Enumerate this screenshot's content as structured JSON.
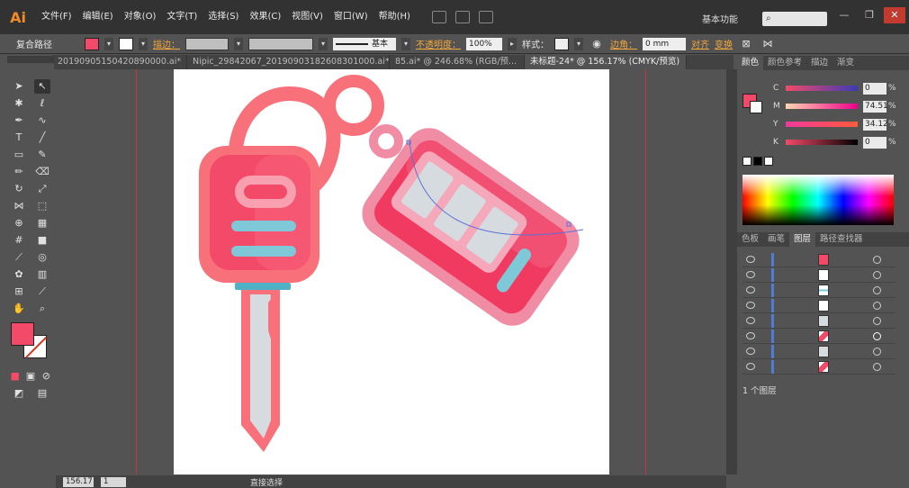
{
  "app": {
    "logo": "Ai"
  },
  "menu": [
    "文件(F)",
    "编辑(E)",
    "对象(O)",
    "文字(T)",
    "选择(S)",
    "效果(C)",
    "视图(V)",
    "窗口(W)",
    "帮助(H)"
  ],
  "workspace_label": "基本功能",
  "search_placeholder": "",
  "control": {
    "object_type": "复合路径",
    "stroke_label": "描边：",
    "stroke_style": "基本",
    "opacity_label": "不透明度：",
    "opacity_value": "100%",
    "style_label": "样式：",
    "corner_label": "边角：",
    "corner_value": "0 mm",
    "align_label": "对齐",
    "transform_label": "变换"
  },
  "tabs": [
    "20190905150420890000.ai*",
    "Nipic_29842067_20190903182608301000.ai*",
    "85.ai* @ 246.68% (RGB/预...",
    "未标题-24* @ 156.17% (CMYK/预览)"
  ],
  "color_panel": {
    "tabs": [
      "颜色",
      "颜色参考",
      "描边",
      "渐变"
    ],
    "channels": [
      {
        "letter": "C",
        "value": "0"
      },
      {
        "letter": "M",
        "value": "74.51"
      },
      {
        "letter": "Y",
        "value": "34.12"
      },
      {
        "letter": "K",
        "value": "0"
      }
    ],
    "pct": "%"
  },
  "layers_panel": {
    "tabs": [
      "色板",
      "画笔",
      "图层",
      "路径查找器"
    ],
    "footer": "1 个图层"
  },
  "status": {
    "zoom": "156.17",
    "page": "1",
    "tool": "直接选择"
  },
  "colors": {
    "fill": "#f24a68",
    "key_head": "#f24a68",
    "key_outline": "#f8717a",
    "blade": "#d6dbe0",
    "stripe": "#7ec8d8",
    "fob_body": "#f03a60",
    "fob_outline": "#f08ca4"
  }
}
